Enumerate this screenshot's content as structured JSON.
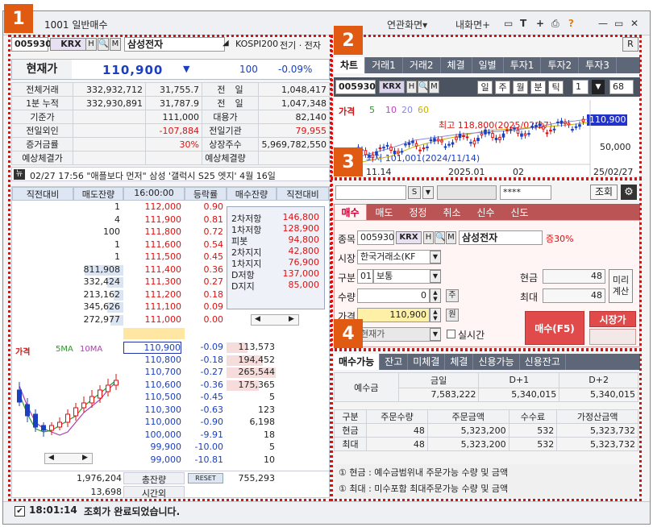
{
  "window": {
    "title": "1001 일반매수",
    "menu": [
      "연관화면▾",
      "내화면+"
    ],
    "icons": [
      "monitor-icon",
      "font-icon",
      "plus-icon",
      "print-icon",
      "help-icon",
      "minimize-icon",
      "maximize-icon",
      "close-icon"
    ]
  },
  "badges": [
    "1",
    "2",
    "3",
    "4"
  ],
  "stock": {
    "code": "005930",
    "market": "KRX",
    "name": "삼성전자",
    "index_label": "KOSPI200",
    "sector": "전기 · 전자",
    "buttons": [
      "H",
      "Q",
      "M"
    ]
  },
  "price": {
    "label": "현재가",
    "value": "110,900",
    "arrow": "▼",
    "change": "100",
    "rate": "-0.09%"
  },
  "info_rows": [
    {
      "l1": "전체거래",
      "v1": "332,932,712",
      "v2": "31,755.7",
      "l2": "전",
      "l2b": "일",
      "v3": "1,048,417"
    },
    {
      "l1": "1분 누적",
      "v1": "332,930,891",
      "v2": "31,787.9",
      "l2": "전",
      "l2b": "일",
      "v3": "1,047,348"
    },
    {
      "l1": "기준가",
      "v1": "",
      "v2": "111,000",
      "l2": "대용가",
      "l2b": "",
      "v3": "82,140"
    },
    {
      "l1": "전일외인",
      "v1": "",
      "v2": "-107,884",
      "l2": "전일기관",
      "l2b": "",
      "v3": "79,955"
    },
    {
      "l1": "증거금률",
      "v1": "",
      "v2": "30%",
      "l2": "상장주수",
      "l2b": "",
      "v3": "5,969,782,550"
    },
    {
      "l1": "예상체결가",
      "v1": "",
      "v2": "",
      "l2": "예상체결량",
      "l2b": "",
      "v3": ""
    }
  ],
  "news": {
    "badge": "뉴",
    "text": "02/27 17:56 \"애플보다 먼저\" 삼성 '갤럭시 S25 엣지' 4월 16일"
  },
  "orderbook": {
    "headers": [
      "직전대비",
      "매도잔량",
      "16:00:00",
      "등락률",
      "매수잔량",
      "직전대비"
    ],
    "asks": [
      {
        "qty": "1",
        "price": "112,000",
        "rate": "0.90"
      },
      {
        "qty": "4",
        "price": "111,900",
        "rate": "0.81"
      },
      {
        "qty": "100",
        "price": "111,800",
        "rate": "0.72"
      },
      {
        "qty": "1",
        "price": "111,600",
        "rate": "0.54"
      },
      {
        "qty": "1",
        "price": "111,500",
        "rate": "0.45"
      },
      {
        "qty": "811,908",
        "price": "111,400",
        "rate": "0.36"
      },
      {
        "qty": "332,424",
        "price": "111,300",
        "rate": "0.27"
      },
      {
        "qty": "213,162",
        "price": "111,200",
        "rate": "0.18"
      },
      {
        "qty": "345,626",
        "price": "111,100",
        "rate": "0.09"
      },
      {
        "qty": "272,977",
        "price": "111,000",
        "rate": "0.00"
      }
    ],
    "ask_bars": [
      0,
      0,
      0,
      0,
      0,
      0.78,
      0.32,
      0.2,
      0.33,
      0.26
    ],
    "levels": [
      {
        "label": "2차저항",
        "value": "146,800"
      },
      {
        "label": "1차저항",
        "value": "128,900"
      },
      {
        "label": "피봇",
        "value": "94,800"
      },
      {
        "label": "2차지지",
        "value": "42,800"
      },
      {
        "label": "1차지지",
        "value": "76,900"
      },
      {
        "label": "D저항",
        "value": "137,000"
      },
      {
        "label": "D지지",
        "value": "85,000"
      }
    ],
    "bids": [
      {
        "price": "110,900",
        "rate": "-0.09",
        "qty": "113,573"
      },
      {
        "price": "110,800",
        "rate": "-0.18",
        "qty": "194,452"
      },
      {
        "price": "110,700",
        "rate": "-0.27",
        "qty": "265,544"
      },
      {
        "price": "110,600",
        "rate": "-0.36",
        "qty": "175,365"
      },
      {
        "price": "110,500",
        "rate": "-0.45",
        "qty": "5"
      },
      {
        "price": "110,300",
        "rate": "-0.63",
        "qty": "123"
      },
      {
        "price": "110,000",
        "rate": "-0.90",
        "qty": "6,198"
      },
      {
        "price": "100,000",
        "rate": "-9.91",
        "qty": "18"
      },
      {
        "price": "99,900",
        "rate": "-10.00",
        "qty": "5"
      },
      {
        "price": "99,000",
        "rate": "-10.81",
        "qty": "10"
      }
    ],
    "bid_bars": [
      0.42,
      0.72,
      0.98,
      0.64,
      0,
      0,
      0,
      0,
      0,
      0
    ],
    "mini_chart": {
      "label": "가격",
      "ma5": "5MA",
      "ma10": "10MA"
    },
    "total_label": "총잔량",
    "total_ask": "1,976,204",
    "total_bid": "755,293",
    "reset_label": "RESET",
    "after_label": "시간외",
    "after_ask": "13,698"
  },
  "chart_panel": {
    "tabs": [
      "차트",
      "거래1",
      "거래2",
      "체결",
      "일별",
      "투자1",
      "투자2",
      "투자3"
    ],
    "period_buttons": [
      "일",
      "주",
      "월",
      "분",
      "틱"
    ],
    "period_value": "1",
    "count": "68",
    "legend_label": "가격",
    "ma_values": [
      "5",
      "10",
      "20",
      "60"
    ],
    "high_label": "최고 118,800(2025/02/27)",
    "low_label": "최저 101,001(2024/11/14)",
    "last_price": "110,900",
    "y_tick": "50,000",
    "x_ticks": [
      "11.14",
      "2025.01",
      "02",
      "25/02/27"
    ],
    "r_button": "R"
  },
  "order": {
    "account_type": "S",
    "password": "****",
    "inquiry_label": "조회",
    "tabs": [
      "매수",
      "매도",
      "정정",
      "취소",
      "신수",
      "신도"
    ],
    "code_label": "종목",
    "code": "005930",
    "market": "KRX",
    "name": "삼성전자",
    "margin": "증30%",
    "market_label": "시장",
    "market_value": "한국거래소(KF",
    "type_label": "구분",
    "type_code": "01",
    "type_value": "보통",
    "qty_label": "수량",
    "qty_value": "0",
    "qty_unit": "주",
    "price_label": "가격",
    "price_value": "110,900",
    "price_unit": "원",
    "price_type": "현재가",
    "realtime_label": "실시간",
    "cash_label": "현금",
    "cash_value": "48",
    "max_label": "최대",
    "max_value": "48",
    "preview_label": "미리계산",
    "buy_button": "매수(F5)",
    "market_price_button": "시장가"
  },
  "account": {
    "tabs": [
      "매수가능",
      "잔고",
      "미체결",
      "체결",
      "신용가능",
      "신용잔고"
    ],
    "deposit_label": "예수금",
    "deposit_headers": [
      "금일",
      "D+1",
      "D+2"
    ],
    "deposit_values": [
      "7,583,222",
      "5,340,015",
      "5,340,015"
    ],
    "table_headers": [
      "구분",
      "주문수량",
      "주문금액",
      "수수료",
      "가정산금액"
    ],
    "rows": [
      {
        "type": "현금",
        "qty": "48",
        "amount": "5,323,200",
        "fee": "532",
        "net": "5,323,732"
      },
      {
        "type": "최대",
        "qty": "48",
        "amount": "5,323,200",
        "fee": "532",
        "net": "5,323,732"
      }
    ],
    "notes": [
      "① 현금 : 예수금범위내 주문가능 수량 및 금액",
      "① 최대 : 미수포함 최대주문가능 수량 및 금액"
    ]
  },
  "status": {
    "time": "18:01:14",
    "message": "조회가 완료되었습니다."
  }
}
